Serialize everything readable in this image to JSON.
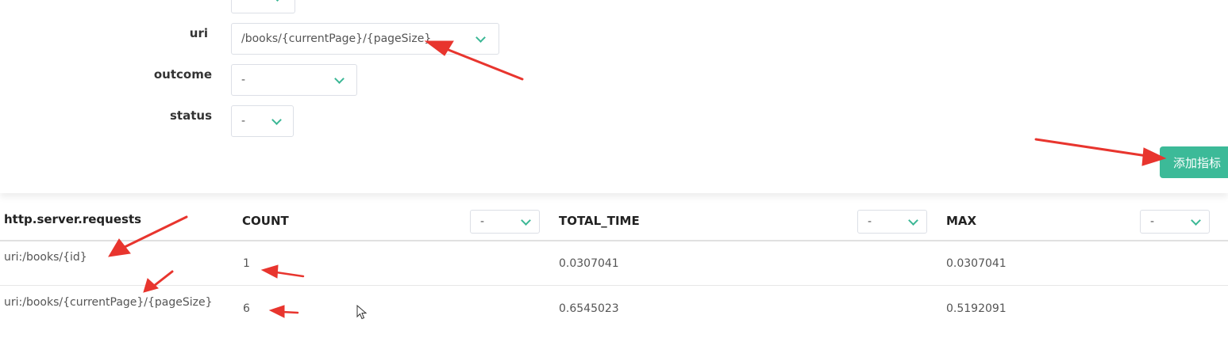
{
  "filters": [
    {
      "label": "uri",
      "value": "/books/{currentPage}/{pageSize}"
    },
    {
      "label": "outcome",
      "value": "-"
    },
    {
      "label": "status",
      "value": "-"
    }
  ],
  "add_button_label": "添加指标",
  "table": {
    "metric_name": "http.server.requests",
    "columns": [
      {
        "label": "COUNT",
        "select_value": "-"
      },
      {
        "label": "TOTAL_TIME",
        "select_value": "-"
      },
      {
        "label": "MAX",
        "select_value": "-"
      }
    ],
    "rows": [
      {
        "tag": "uri:/books/{id}",
        "count": "1",
        "total_time": "0.0307041",
        "max": "0.0307041"
      },
      {
        "tag": "uri:/books/{currentPage}/{pageSize}",
        "count": "6",
        "total_time": "0.6545023",
        "max": "0.5192091"
      }
    ]
  },
  "colors": {
    "accent": "#3cba98",
    "annotation": "#e8352e"
  },
  "icons": [
    "chevron-down-icon",
    "annotation-arrow",
    "mouse-cursor-icon"
  ]
}
